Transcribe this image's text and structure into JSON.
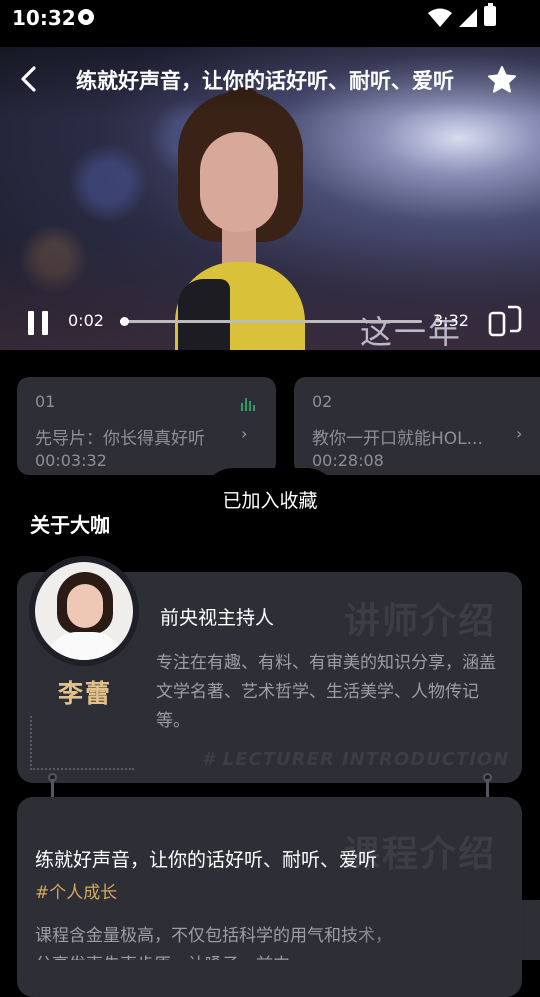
{
  "status_bar": {
    "time": "10:32"
  },
  "player": {
    "title": "练就好声音，让你的话好听、耐听、爱听",
    "caption": "这一年",
    "current_time": "0:02",
    "total_time": "3:32",
    "progress": 0.01,
    "icons": {
      "back": "back-arrow-icon",
      "favorite": "star-icon",
      "pause": "pause-icon",
      "fullscreen": "fullscreen-icon"
    }
  },
  "episodes": [
    {
      "number": "01",
      "title": "先导片：你长得真好听",
      "duration": "00:03:32",
      "playing": true
    },
    {
      "number": "02",
      "title": "教你一开口就能HOL...",
      "duration": "00:28:08",
      "playing": false
    }
  ],
  "toast": {
    "text": "已加入收藏"
  },
  "about": {
    "heading": "关于大咖",
    "watermark_cn": "讲师介绍",
    "watermark_en": "# LECTURER INTRODUCTION",
    "name": "李蕾",
    "role": "前央视主持人",
    "bio": "专注在有趣、有料、有审美的知识分享，涵盖文学名著、艺术哲学、生活美学、人物传记等。"
  },
  "course": {
    "watermark_cn": "课程介绍",
    "title": "练就好声音，让你的话好听、耐听、爱听",
    "tag": "#个人成长",
    "desc": "课程含金量极高，不仅包括科学的用气和技术，分享发声先声步原、让嗓子、前中..."
  },
  "colors": {
    "accent_gold": "#e3c18a",
    "tag_gold": "#d4a95c",
    "card_bg": "#2d2e36",
    "playing_green": "#2e9a66"
  }
}
